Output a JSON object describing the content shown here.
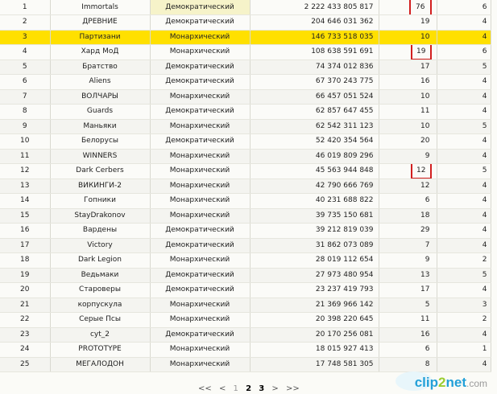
{
  "rows": [
    {
      "rank": "1",
      "name": "Immortals",
      "gov": "Демократический",
      "score": "2 222 433 805 817",
      "a": "76",
      "b": "6"
    },
    {
      "rank": "2",
      "name": "ДРЕВНИЕ",
      "gov": "Демократический",
      "score": "204 646 031 362",
      "a": "19",
      "b": "4"
    },
    {
      "rank": "3",
      "name": "Партизани",
      "gov": "Монархический",
      "score": "146 733 518 035",
      "a": "10",
      "b": "4"
    },
    {
      "rank": "4",
      "name": "Хард МоД",
      "gov": "Монархический",
      "score": "108 638 591 691",
      "a": "19",
      "b": "6"
    },
    {
      "rank": "5",
      "name": "Братство",
      "gov": "Демократический",
      "score": "74 374 012 836",
      "a": "17",
      "b": "5"
    },
    {
      "rank": "6",
      "name": "Aliens",
      "gov": "Демократический",
      "score": "67 370 243 775",
      "a": "16",
      "b": "4"
    },
    {
      "rank": "7",
      "name": "ВОЛЧАРЫ",
      "gov": "Монархический",
      "score": "66 457 051 524",
      "a": "10",
      "b": "4"
    },
    {
      "rank": "8",
      "name": "Guards",
      "gov": "Демократический",
      "score": "62 857 647 455",
      "a": "11",
      "b": "4"
    },
    {
      "rank": "9",
      "name": "Маньяки",
      "gov": "Монархический",
      "score": "62 542 311 123",
      "a": "10",
      "b": "5"
    },
    {
      "rank": "10",
      "name": "Белорусы",
      "gov": "Демократический",
      "score": "52 420 354 564",
      "a": "20",
      "b": "4"
    },
    {
      "rank": "11",
      "name": "WINNERS",
      "gov": "Монархический",
      "score": "46 019 809 296",
      "a": "9",
      "b": "4"
    },
    {
      "rank": "12",
      "name": "Dark Cerbers",
      "gov": "Монархический",
      "score": "45 563 944 848",
      "a": "12",
      "b": "5"
    },
    {
      "rank": "13",
      "name": "ВИКИНГИ-2",
      "gov": "Монархический",
      "score": "42 790 666 769",
      "a": "12",
      "b": "4"
    },
    {
      "rank": "14",
      "name": "Гопники",
      "gov": "Монархический",
      "score": "40 231 688 822",
      "a": "6",
      "b": "4"
    },
    {
      "rank": "15",
      "name": "StayDrakonov",
      "gov": "Монархический",
      "score": "39 735 150 681",
      "a": "18",
      "b": "4"
    },
    {
      "rank": "16",
      "name": "Вардены",
      "gov": "Демократический",
      "score": "39 212 819 039",
      "a": "29",
      "b": "4"
    },
    {
      "rank": "17",
      "name": "Victory",
      "gov": "Демократический",
      "score": "31 862 073 089",
      "a": "7",
      "b": "4"
    },
    {
      "rank": "18",
      "name": "Dark Legion",
      "gov": "Монархический",
      "score": "28 019 112 654",
      "a": "9",
      "b": "2"
    },
    {
      "rank": "19",
      "name": "Ведьмаки",
      "gov": "Демократический",
      "score": "27 973 480 954",
      "a": "13",
      "b": "5"
    },
    {
      "rank": "20",
      "name": "Староверы",
      "gov": "Демократический",
      "score": "23 237 419 793",
      "a": "17",
      "b": "4"
    },
    {
      "rank": "21",
      "name": "корпускула",
      "gov": "Монархический",
      "score": "21 369 966 142",
      "a": "5",
      "b": "3"
    },
    {
      "rank": "22",
      "name": "Серые Псы",
      "gov": "Монархический",
      "score": "20 398 220 645",
      "a": "11",
      "b": "2"
    },
    {
      "rank": "23",
      "name": "cyt_2",
      "gov": "Демократический",
      "score": "20 170 256 081",
      "a": "16",
      "b": "4"
    },
    {
      "rank": "24",
      "name": "PROTOTYPE",
      "gov": "Монархический",
      "score": "18 015 927 413",
      "a": "6",
      "b": "1"
    },
    {
      "rank": "25",
      "name": "МЕГАЛОДОН",
      "gov": "Монархический",
      "score": "17 748 581 305",
      "a": "8",
      "b": "4"
    }
  ],
  "highlighted_rank": "3",
  "boxed_values_ranks": [
    "1",
    "4",
    "12"
  ],
  "pager": {
    "first": "<<",
    "prev": "<",
    "page1": "1",
    "page2": "2",
    "page3": "3",
    "next": ">",
    "last": ">>"
  },
  "watermark": {
    "part1": "clip",
    "part2": "2",
    "part3": "net",
    "part4": ".com"
  },
  "colors": {
    "highlight": "#ffe000",
    "box": "#d21f1f",
    "watermark_blue": "#23a0d8"
  }
}
